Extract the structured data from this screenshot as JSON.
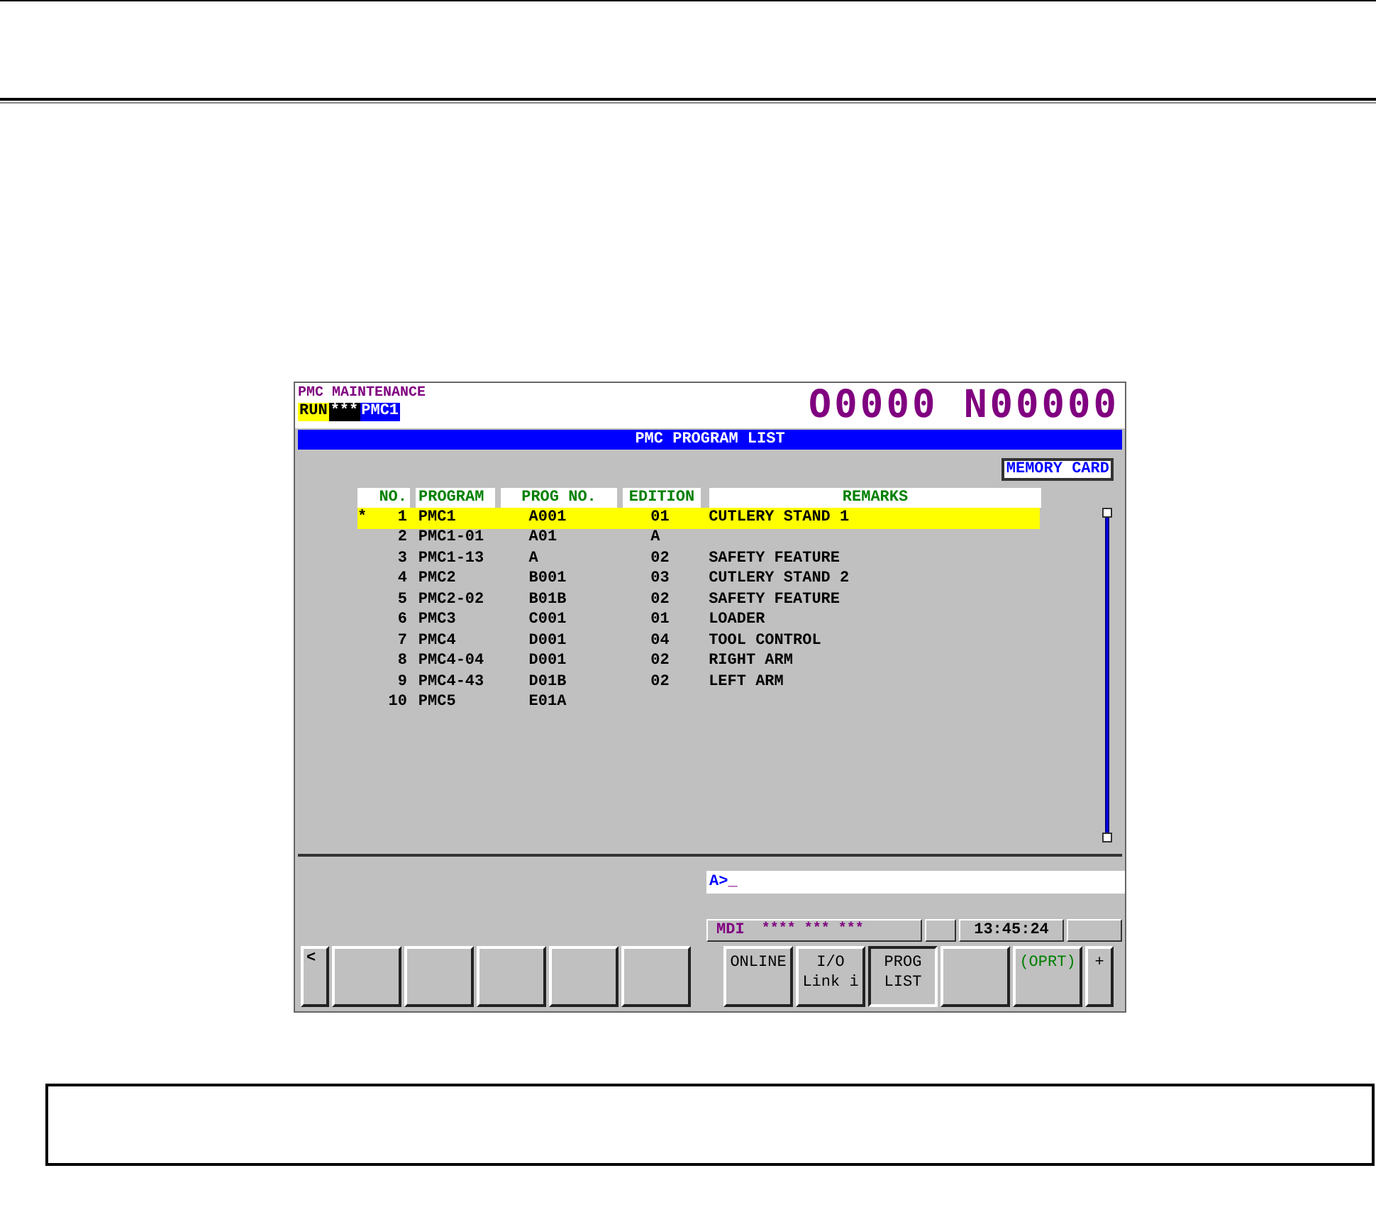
{
  "screen": {
    "header": {
      "title": "PMC MAINTENANCE",
      "tags": [
        {
          "text": "RUN",
          "kind": "run"
        },
        {
          "text": "***",
          "kind": "alarm"
        },
        {
          "text": "PMC1",
          "kind": "path"
        }
      ],
      "program_number": "O0000 N00000"
    },
    "title": "PMC PROGRAM LIST",
    "memory_card": "MEMORY CARD",
    "table": {
      "columns": [
        "NO.",
        "PROGRAM",
        "PROG NO.",
        "EDITION",
        "REMARKS"
      ],
      "rows": [
        {
          "marker": "*",
          "no": "1",
          "program": "PMC1",
          "prog_no": "A001",
          "edition": "01",
          "remarks": "CUTLERY STAND 1",
          "selected": true
        },
        {
          "no": "2",
          "program": "PMC1-01",
          "prog_no": "A01",
          "edition": "A",
          "selected": false
        },
        {
          "no": "3",
          "program": "PMC1-13",
          "prog_no": "A",
          "edition": "02",
          "remarks": "SAFETY FEATURE",
          "selected": false
        },
        {
          "no": "4",
          "program": "PMC2",
          "prog_no": "B001",
          "edition": "03",
          "remarks": "CUTLERY STAND 2",
          "selected": false
        },
        {
          "no": "5",
          "program": "PMC2-02",
          "prog_no": "B01B",
          "edition": "02",
          "remarks": "SAFETY FEATURE",
          "selected": false
        },
        {
          "no": "6",
          "program": "PMC3",
          "prog_no": "C001",
          "edition": "01",
          "remarks": "LOADER",
          "selected": false
        },
        {
          "no": "7",
          "program": "PMC4",
          "prog_no": "D001",
          "edition": "04",
          "remarks": "TOOL CONTROL",
          "selected": false
        },
        {
          "no": "8",
          "program": "PMC4-04",
          "prog_no": "D001",
          "edition": "02",
          "remarks": "RIGHT ARM",
          "selected": false
        },
        {
          "no": "9",
          "program": "PMC4-43",
          "prog_no": "D01B",
          "edition": "02",
          "remarks": "LEFT ARM",
          "selected": false
        },
        {
          "no": "10",
          "program": "PMC5",
          "prog_no": "E01A",
          "selected": false
        }
      ]
    },
    "input": {
      "prompt": "A>",
      "cursor": "_"
    },
    "status_bar": {
      "mode": "MDI",
      "alarm": "**** *** ***",
      "time": "13:45:24"
    },
    "softkeys_left": [
      {
        "label": "<",
        "kind": "prev"
      },
      {
        "kind": "blank"
      },
      {
        "kind": "blank"
      },
      {
        "kind": "blank"
      },
      {
        "kind": "blank"
      },
      {
        "kind": "blank"
      }
    ],
    "softkeys_right": [
      {
        "lines": [
          "ONLINE"
        ],
        "selected": false
      },
      {
        "lines": [
          "I/O",
          "Link i"
        ],
        "selected": false
      },
      {
        "lines": [
          "PROG",
          "LIST"
        ],
        "selected": true
      },
      {
        "selected": false,
        "kind": "blank"
      },
      {
        "lines": [
          "(OPRT)"
        ],
        "selected": false,
        "kind": "operation"
      },
      {
        "lines": [
          "+"
        ],
        "selected": false,
        "kind": "next"
      }
    ]
  }
}
